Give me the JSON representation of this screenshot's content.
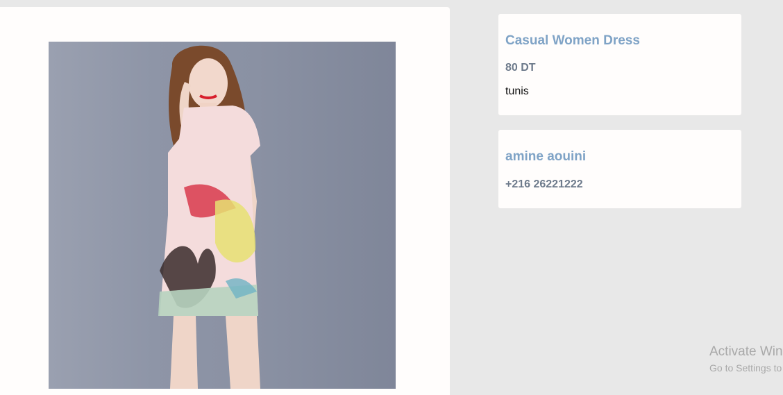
{
  "product": {
    "title": "Casual Women Dress",
    "price": "80 DT",
    "location": "tunis"
  },
  "seller": {
    "name": "amine aouini",
    "phone": "+216 26221222"
  },
  "watermark": {
    "title": "Activate Win",
    "subtitle": "Go to Settings to"
  }
}
